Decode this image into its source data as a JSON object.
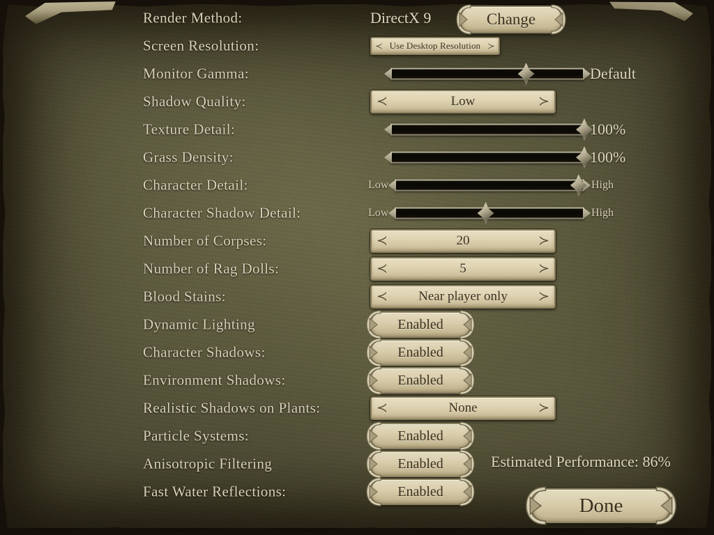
{
  "screen": {
    "estimated_performance": "Estimated Performance: 86%",
    "done_label": "Done"
  },
  "icons": {
    "chevron_left": "≺",
    "chevron_right": "≻"
  },
  "rows": [
    {
      "label": "Render Method:",
      "kind": "text-plus-button",
      "value": "DirectX 9",
      "button_label": "Change"
    },
    {
      "label": "Screen Resolution:",
      "kind": "selector-small",
      "value": "Use Desktop Resolution"
    },
    {
      "label": "Monitor Gamma:",
      "kind": "slider",
      "percent": 70,
      "value_label": "Default",
      "left_label": "",
      "right_label": ""
    },
    {
      "label": "Shadow Quality:",
      "kind": "selector",
      "value": "Low"
    },
    {
      "label": "Texture Detail:",
      "kind": "slider",
      "percent": 100,
      "value_label": "100%",
      "left_label": "",
      "right_label": ""
    },
    {
      "label": "Grass Density:",
      "kind": "slider",
      "percent": 100,
      "value_label": "100%",
      "left_label": "",
      "right_label": ""
    },
    {
      "label": "Character Detail:",
      "kind": "slider",
      "percent": 97,
      "value_label": "",
      "left_label": "Low",
      "right_label": "High"
    },
    {
      "label": "Character Shadow Detail:",
      "kind": "slider",
      "percent": 48,
      "value_label": "",
      "left_label": "Low",
      "right_label": "High"
    },
    {
      "label": "Number of Corpses:",
      "kind": "selector",
      "value": "20"
    },
    {
      "label": "Number of Rag Dolls:",
      "kind": "selector",
      "value": "5"
    },
    {
      "label": "Blood Stains:",
      "kind": "selector",
      "value": "Near player only"
    },
    {
      "label": "Dynamic Lighting",
      "kind": "pill",
      "value": "Enabled"
    },
    {
      "label": "Character Shadows:",
      "kind": "pill",
      "value": "Enabled"
    },
    {
      "label": "Environment Shadows:",
      "kind": "pill",
      "value": "Enabled"
    },
    {
      "label": "Realistic Shadows on Plants:",
      "kind": "selector",
      "value": "None"
    },
    {
      "label": "Particle Systems:",
      "kind": "pill",
      "value": "Enabled"
    },
    {
      "label": "Anisotropic Filtering",
      "kind": "pill",
      "value": "Enabled"
    },
    {
      "label": "Fast Water Reflections:",
      "kind": "pill",
      "value": "Enabled"
    }
  ]
}
